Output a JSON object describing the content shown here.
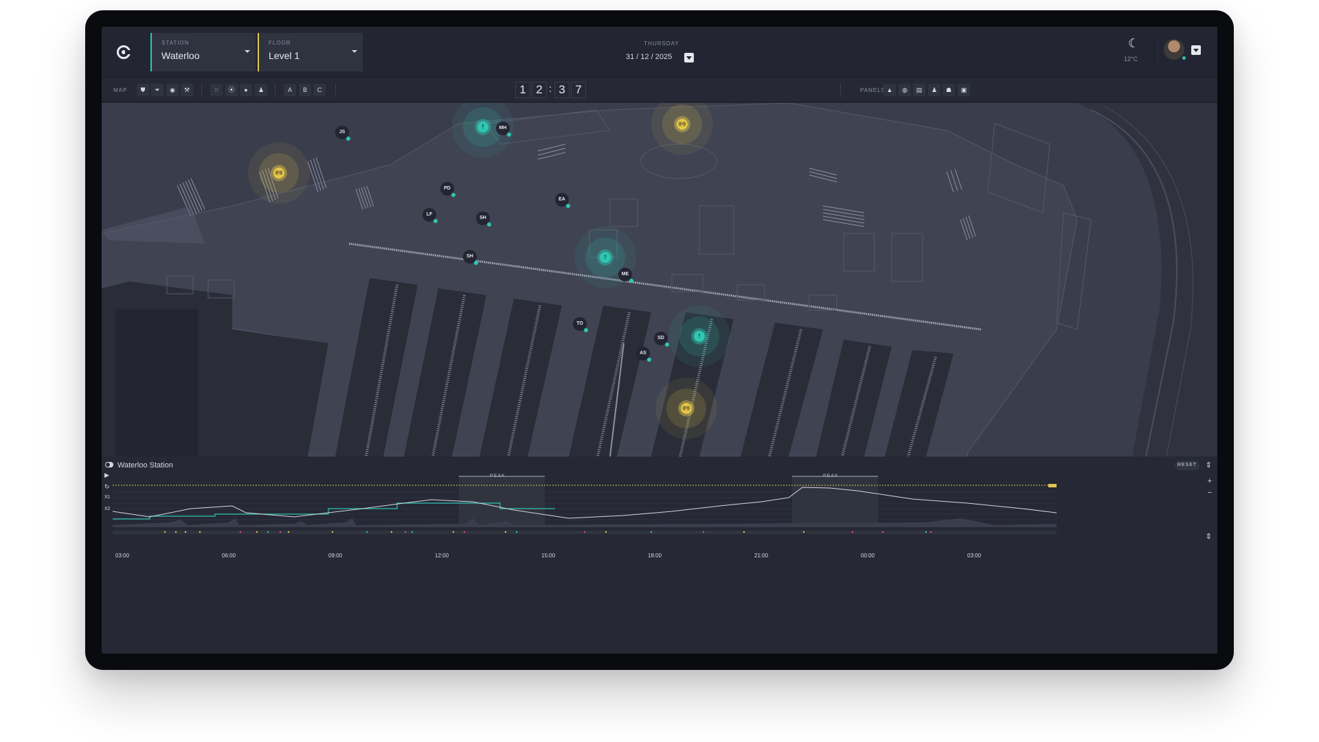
{
  "header": {
    "station_label": "STATION",
    "station_value": "Waterloo",
    "floor_label": "FLOOR",
    "floor_value": "Level 1",
    "day": "THURSDAY",
    "date": "31 / 12 / 2025",
    "temperature": "12°C",
    "weather_icon": "moon-icon"
  },
  "toolbar": {
    "map_label": "MAP",
    "map_tools": [
      "shield-icon",
      "filter-icon",
      "target-icon",
      "wrench-icon"
    ],
    "layer_tools": [
      "grid-icon",
      "signal-icon",
      "pin-icon",
      "person-icon"
    ],
    "zones": [
      "A",
      "B",
      "C"
    ],
    "clock_digits": [
      "1",
      "2",
      "3",
      "7"
    ],
    "clock_separator": ":",
    "panels_label": "PANELS",
    "panel_tools": [
      "alert-icon",
      "eye-icon",
      "clipboard-icon",
      "person-icon",
      "group-icon",
      "train-icon"
    ]
  },
  "map": {
    "staff_markers": [
      {
        "initials": "JS"
      },
      {
        "initials": "MH"
      },
      {
        "initials": "PD"
      },
      {
        "initials": "EA"
      },
      {
        "initials": "LF"
      },
      {
        "initials": "SH"
      },
      {
        "initials": "SH"
      },
      {
        "initials": "ME"
      },
      {
        "initials": "TO"
      },
      {
        "initials": "SD"
      },
      {
        "initials": "AS"
      }
    ],
    "alerts": [
      {
        "type": "incident",
        "symbol": "!",
        "color": "#2fc6b2"
      },
      {
        "type": "incident",
        "symbol": "!",
        "color": "#2fc6b2"
      },
      {
        "type": "incident",
        "symbol": "!",
        "color": "#2fc6b2"
      },
      {
        "type": "broadcast",
        "symbol": "((•))",
        "color": "#e5c74a"
      },
      {
        "type": "broadcast",
        "symbol": "((•))",
        "color": "#e5c74a"
      },
      {
        "type": "broadcast",
        "symbol": "((•))",
        "color": "#e5c74a"
      }
    ]
  },
  "timeline": {
    "title": "Waterloo Station",
    "reset_label": "RESET",
    "peak_label": "PEAK",
    "x1_label": "X1",
    "x2_label": "X2",
    "ticks": [
      "03:00",
      "06:00",
      "09:00",
      "12:00",
      "15:00",
      "18:00",
      "21:00",
      "00:00",
      "03:00"
    ],
    "accent_colors": {
      "teal": "#2fc6b2",
      "gold": "#e5c74a",
      "red": "#e2506a"
    }
  }
}
